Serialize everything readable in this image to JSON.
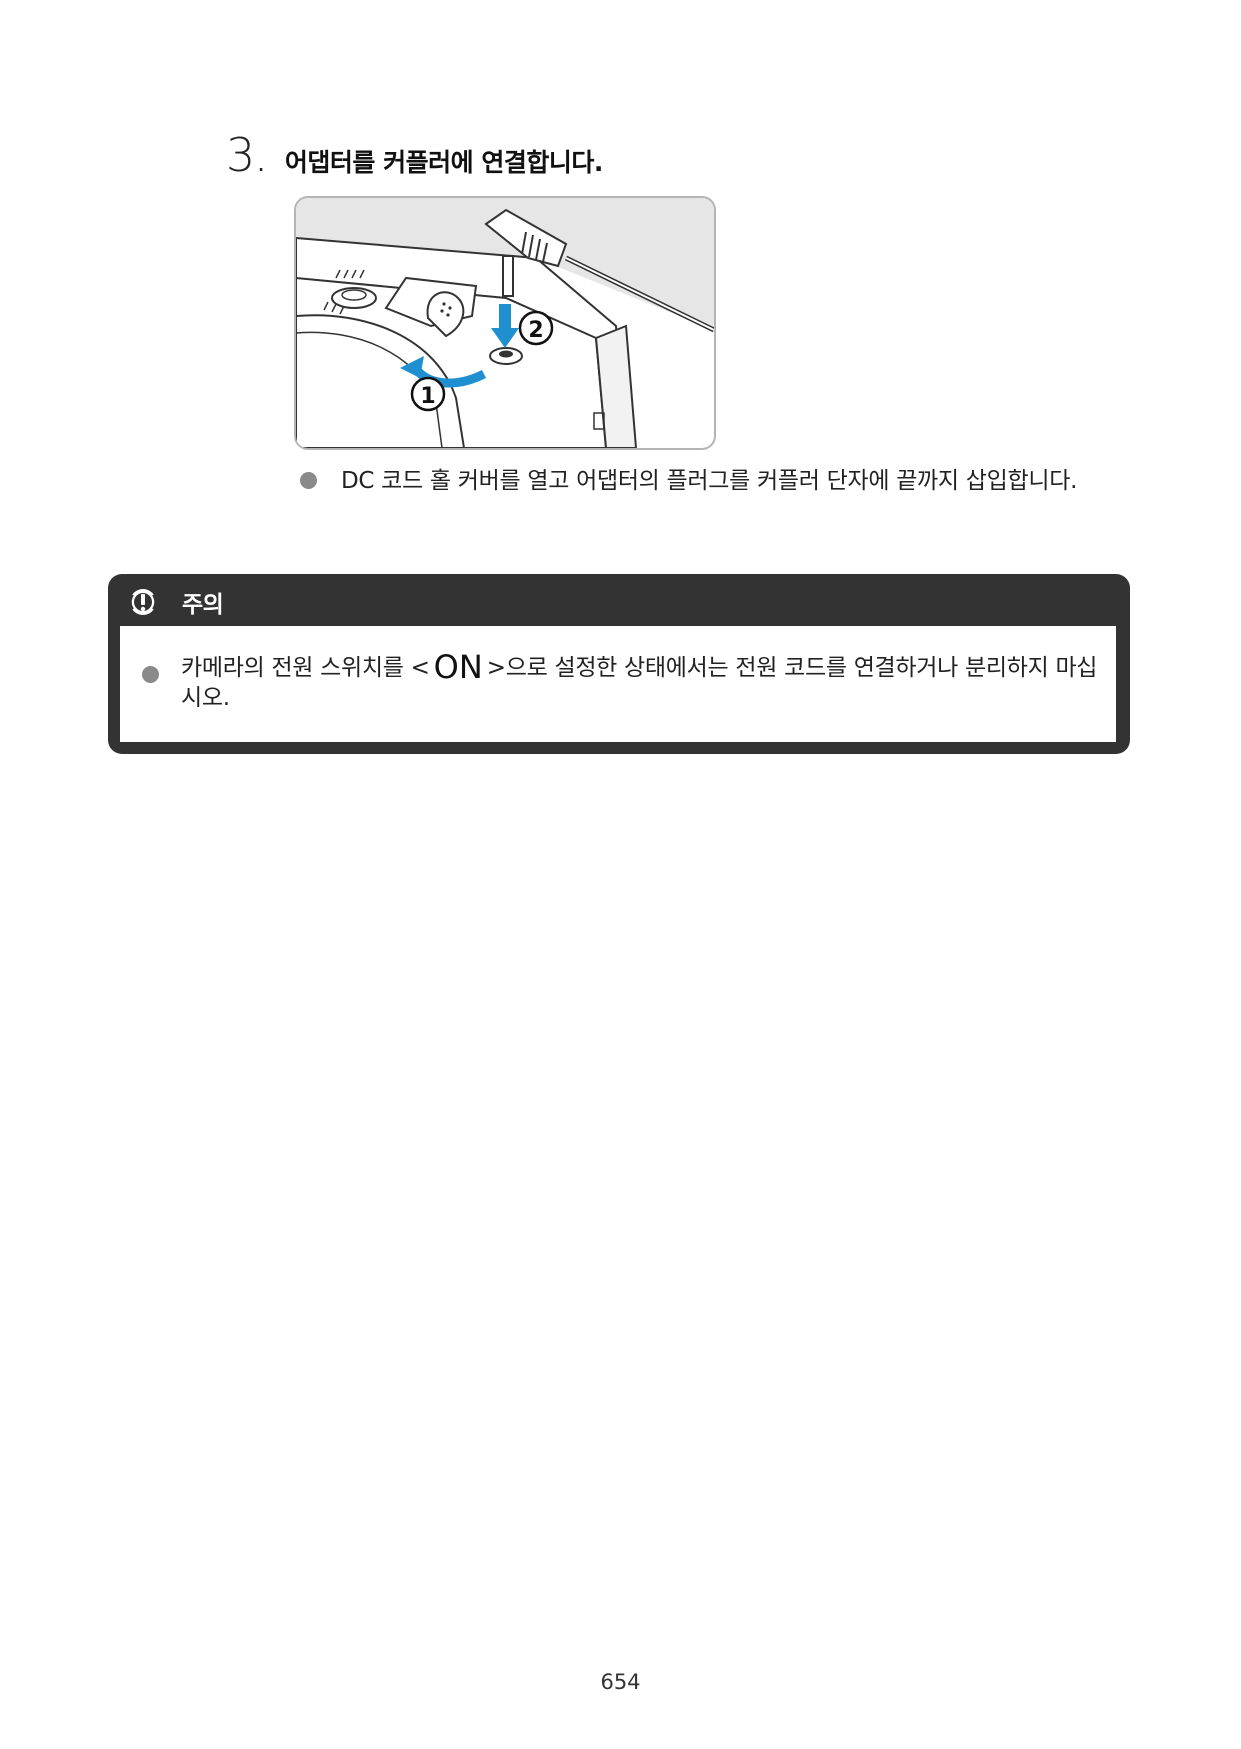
{
  "step": {
    "number": "3",
    "dot": ".",
    "title": "어댑터를 커플러에 연결합니다."
  },
  "illustration": {
    "callouts": [
      "①",
      "②"
    ],
    "colors": {
      "arrow": "#1f8fd0",
      "line": "#333333",
      "background_panel": "#e6e6e6"
    }
  },
  "instruction": {
    "text": "DC 코드 홀 커버를 열고 어댑터의 플러그를 커플러 단자에 끝까지 삽입합니다."
  },
  "caution": {
    "icon": "caution-icon",
    "title": "주의",
    "text_before": "카메라의 전원 스위치를 ",
    "bracket_open": "<",
    "symbol": "ON",
    "bracket_close": ">",
    "text_after": "으로 설정한 상태에서는 전원 코드를 연결하거나 분리하지 마십시오."
  },
  "footer": {
    "page_number": "654"
  }
}
